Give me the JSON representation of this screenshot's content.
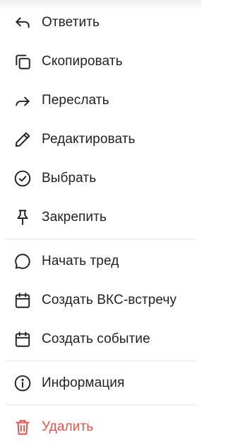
{
  "menu": {
    "group1": [
      {
        "name": "reply",
        "label": "Ответить",
        "icon": "reply-arrow-icon"
      },
      {
        "name": "copy",
        "label": "Скопировать",
        "icon": "copy-icon"
      },
      {
        "name": "forward",
        "label": "Переслать",
        "icon": "forward-arrow-icon"
      },
      {
        "name": "edit",
        "label": "Редактировать",
        "icon": "pencil-icon"
      },
      {
        "name": "select",
        "label": "Выбрать",
        "icon": "check-circle-icon"
      },
      {
        "name": "pin",
        "label": "Закрепить",
        "icon": "pin-icon"
      }
    ],
    "group2": [
      {
        "name": "start-thread",
        "label": "Начать тред",
        "icon": "chat-bubble-icon"
      },
      {
        "name": "create-vcs-meeting",
        "label": "Создать ВКС-встречу",
        "icon": "calendar-icon"
      },
      {
        "name": "create-event",
        "label": "Создать событие",
        "icon": "calendar-icon"
      }
    ],
    "group3": [
      {
        "name": "info",
        "label": "Информация",
        "icon": "info-circle-icon"
      }
    ],
    "group4": [
      {
        "name": "delete",
        "label": "Удалить",
        "icon": "trash-icon"
      }
    ]
  },
  "colors": {
    "text": "#222222",
    "danger": "#e5534b",
    "divider": "#e8e8e8"
  }
}
